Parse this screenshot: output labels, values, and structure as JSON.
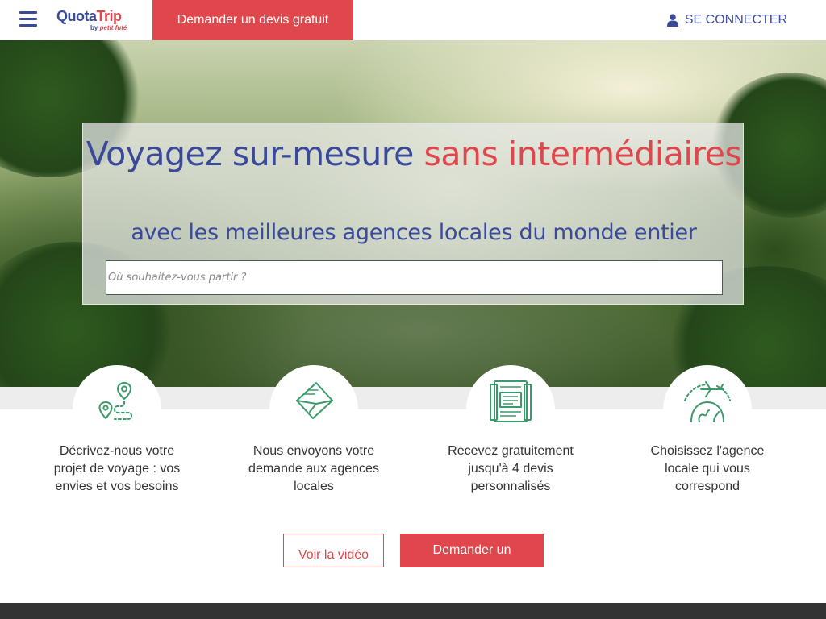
{
  "header": {
    "brand_quota": "Quota",
    "brand_trip": "Trip",
    "brand_by": "by",
    "brand_pf": "petit futé",
    "cta": "Demander un devis gratuit",
    "login": "SE CONNECTER"
  },
  "hero": {
    "title_blue": "Voyagez sur-mesure",
    "title_red": "sans intermédiaires",
    "subtitle": "avec les meilleures agences locales du monde entier",
    "search_placeholder": "Où souhaitez-vous partir ?"
  },
  "steps": [
    {
      "icon": "map-route-icon",
      "text": "Décrivez-nous votre projet de voyage : vos envies et vos besoins"
    },
    {
      "icon": "envelope-icon",
      "text": "Nous envoyons votre demande aux agences locales"
    },
    {
      "icon": "document-quote-icon",
      "text": "Recevez gratuitement jusqu'à 4 devis personnalisés"
    },
    {
      "icon": "plane-globe-icon",
      "text": "Choisissez l'agence locale qui vous correspond"
    }
  ],
  "actions": {
    "video": "Voir la vidéo",
    "quote": "Demander un"
  },
  "colors": {
    "brand_blue": "#3a4a9a",
    "brand_red": "#e0474c",
    "icon_green": "#3a9a6a"
  }
}
